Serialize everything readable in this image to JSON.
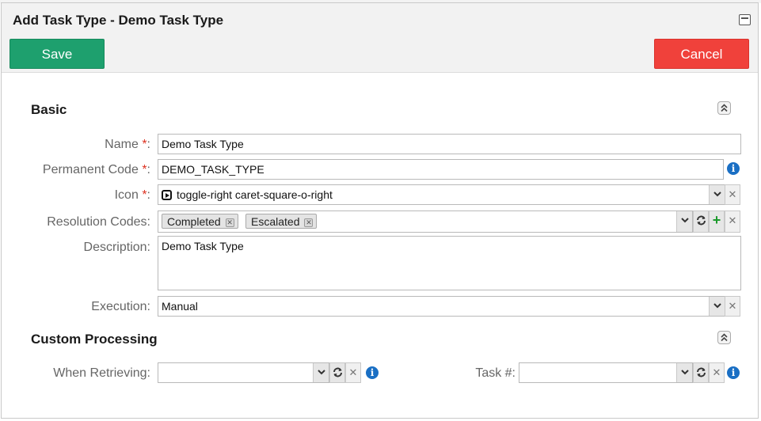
{
  "dialog": {
    "title": "Add Task Type - Demo Task Type",
    "save_label": "Save",
    "cancel_label": "Cancel"
  },
  "basic": {
    "section_title": "Basic",
    "name": {
      "label": "Name",
      "required": "*",
      "colon": ":",
      "value": "Demo Task Type"
    },
    "permanent_code": {
      "label": "Permanent Code",
      "required": "*",
      "colon": ":",
      "value": "DEMO_TASK_TYPE"
    },
    "icon": {
      "label": "Icon",
      "required": "*",
      "colon": ":",
      "value": "toggle-right caret-square-o-right",
      "icon_name": "caret-square-o-right-icon"
    },
    "resolution_codes": {
      "label": "Resolution Codes:",
      "tags": [
        "Completed",
        "Escalated"
      ]
    },
    "description": {
      "label": "Description:",
      "value": "Demo Task Type"
    },
    "execution": {
      "label": "Execution:",
      "value": "Manual"
    }
  },
  "custom_processing": {
    "section_title": "Custom Processing",
    "when_retrieving": {
      "label": "When Retrieving:",
      "value": ""
    },
    "task_number": {
      "label": "Task #:",
      "value": ""
    }
  },
  "colors": {
    "save": "#1ea06e",
    "cancel": "#f0413b",
    "required": "#dd3322",
    "info": "#1a6fc4",
    "add": "#1b9a2b"
  }
}
